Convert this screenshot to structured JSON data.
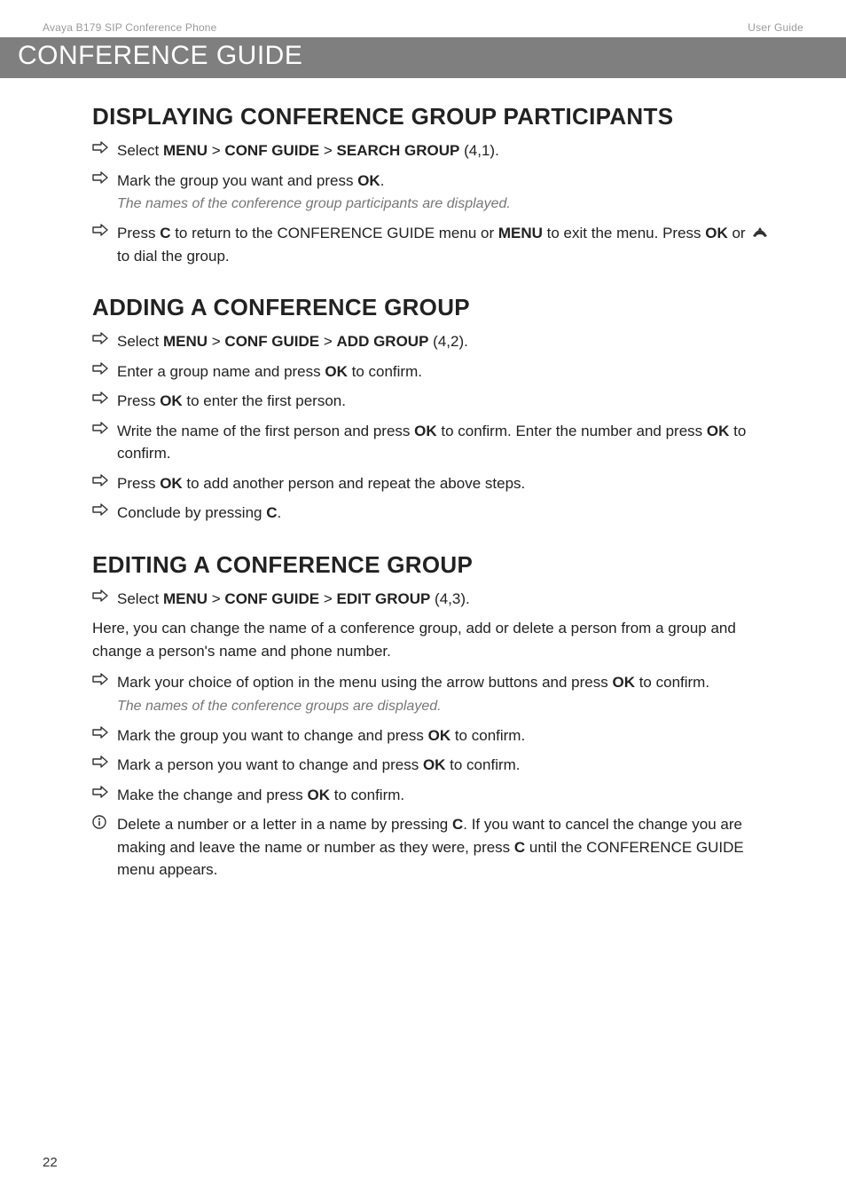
{
  "header": {
    "left": "Avaya B179 SIP Conference Phone",
    "right": "User Guide"
  },
  "banner": "CONFERENCE GUIDE",
  "sections": [
    {
      "title": "DISPLAYING CONFERENCE GROUP PARTICIPANTS",
      "items": [
        {
          "marker": "arrow",
          "runs": [
            {
              "t": "Select "
            },
            {
              "t": "MENU",
              "b": true
            },
            {
              "t": " > "
            },
            {
              "t": "CONF GUIDE",
              "b": true
            },
            {
              "t": " > "
            },
            {
              "t": "SEARCH GROUP",
              "b": true
            },
            {
              "t": " (4,1)."
            }
          ]
        },
        {
          "marker": "arrow",
          "runs": [
            {
              "t": "Mark the group you want and press "
            },
            {
              "t": "OK",
              "b": true
            },
            {
              "t": "."
            }
          ],
          "note": "The names of the conference group participants are displayed."
        },
        {
          "marker": "arrow",
          "runs": [
            {
              "t": "Press "
            },
            {
              "t": "C",
              "b": true
            },
            {
              "t": " to return to the CONFERENCE GUIDE menu or "
            },
            {
              "t": "MENU",
              "b": true
            },
            {
              "t": " to exit the menu. Press "
            },
            {
              "t": "OK",
              "b": true
            },
            {
              "t": " or "
            },
            {
              "t": "",
              "handset": true
            },
            {
              "t": " to dial the group."
            }
          ]
        }
      ]
    },
    {
      "title": "ADDING A CONFERENCE GROUP",
      "items": [
        {
          "marker": "arrow",
          "runs": [
            {
              "t": "Select "
            },
            {
              "t": "MENU",
              "b": true
            },
            {
              "t": " > "
            },
            {
              "t": "CONF GUIDE",
              "b": true
            },
            {
              "t": " > "
            },
            {
              "t": "ADD GROUP",
              "b": true
            },
            {
              "t": " (4,2)."
            }
          ]
        },
        {
          "marker": "arrow",
          "runs": [
            {
              "t": "Enter a group name and press "
            },
            {
              "t": "OK",
              "b": true
            },
            {
              "t": " to confirm."
            }
          ]
        },
        {
          "marker": "arrow",
          "runs": [
            {
              "t": "Press "
            },
            {
              "t": "OK",
              "b": true
            },
            {
              "t": " to enter the first person."
            }
          ]
        },
        {
          "marker": "arrow",
          "runs": [
            {
              "t": "Write the name of the first person and press "
            },
            {
              "t": "OK",
              "b": true
            },
            {
              "t": " to confirm. Enter the number and press "
            },
            {
              "t": "OK",
              "b": true
            },
            {
              "t": " to confirm."
            }
          ]
        },
        {
          "marker": "arrow",
          "runs": [
            {
              "t": "Press "
            },
            {
              "t": "OK",
              "b": true
            },
            {
              "t": " to add another person and repeat the above steps."
            }
          ]
        },
        {
          "marker": "arrow",
          "runs": [
            {
              "t": "Conclude by pressing "
            },
            {
              "t": "C",
              "b": true
            },
            {
              "t": "."
            }
          ]
        }
      ]
    },
    {
      "title": "EDITING A CONFERENCE GROUP",
      "items": [
        {
          "marker": "arrow",
          "runs": [
            {
              "t": "Select "
            },
            {
              "t": "MENU",
              "b": true
            },
            {
              "t": " > "
            },
            {
              "t": "CONF GUIDE",
              "b": true
            },
            {
              "t": " > "
            },
            {
              "t": "EDIT GROUP",
              "b": true
            },
            {
              "t": " (4,3)."
            }
          ]
        }
      ],
      "para_after_first": "Here, you can change the name of a conference group, add or delete a person from a group and change a person's name and phone number.",
      "items2": [
        {
          "marker": "arrow",
          "runs": [
            {
              "t": "Mark your choice of option in the menu using the arrow buttons and press "
            },
            {
              "t": "OK",
              "b": true
            },
            {
              "t": " to confirm."
            }
          ],
          "note": "The names of the conference groups are displayed."
        },
        {
          "marker": "arrow",
          "runs": [
            {
              "t": "Mark the group you want to change and press "
            },
            {
              "t": "OK",
              "b": true
            },
            {
              "t": " to confirm."
            }
          ]
        },
        {
          "marker": "arrow",
          "runs": [
            {
              "t": "Mark a person you want to change and press "
            },
            {
              "t": "OK",
              "b": true
            },
            {
              "t": " to confirm."
            }
          ]
        },
        {
          "marker": "arrow",
          "runs": [
            {
              "t": "Make the change and press "
            },
            {
              "t": "OK",
              "b": true
            },
            {
              "t": " to confirm."
            }
          ]
        },
        {
          "marker": "info",
          "runs": [
            {
              "t": "Delete a number or a letter in a name by pressing "
            },
            {
              "t": "C",
              "b": true
            },
            {
              "t": ". If you want to cancel the change you are making and leave the name or number as they were, press "
            },
            {
              "t": "C",
              "b": true
            },
            {
              "t": " until the CONFERENCE GUIDE menu appears."
            }
          ]
        }
      ]
    }
  ],
  "page_number": "22"
}
